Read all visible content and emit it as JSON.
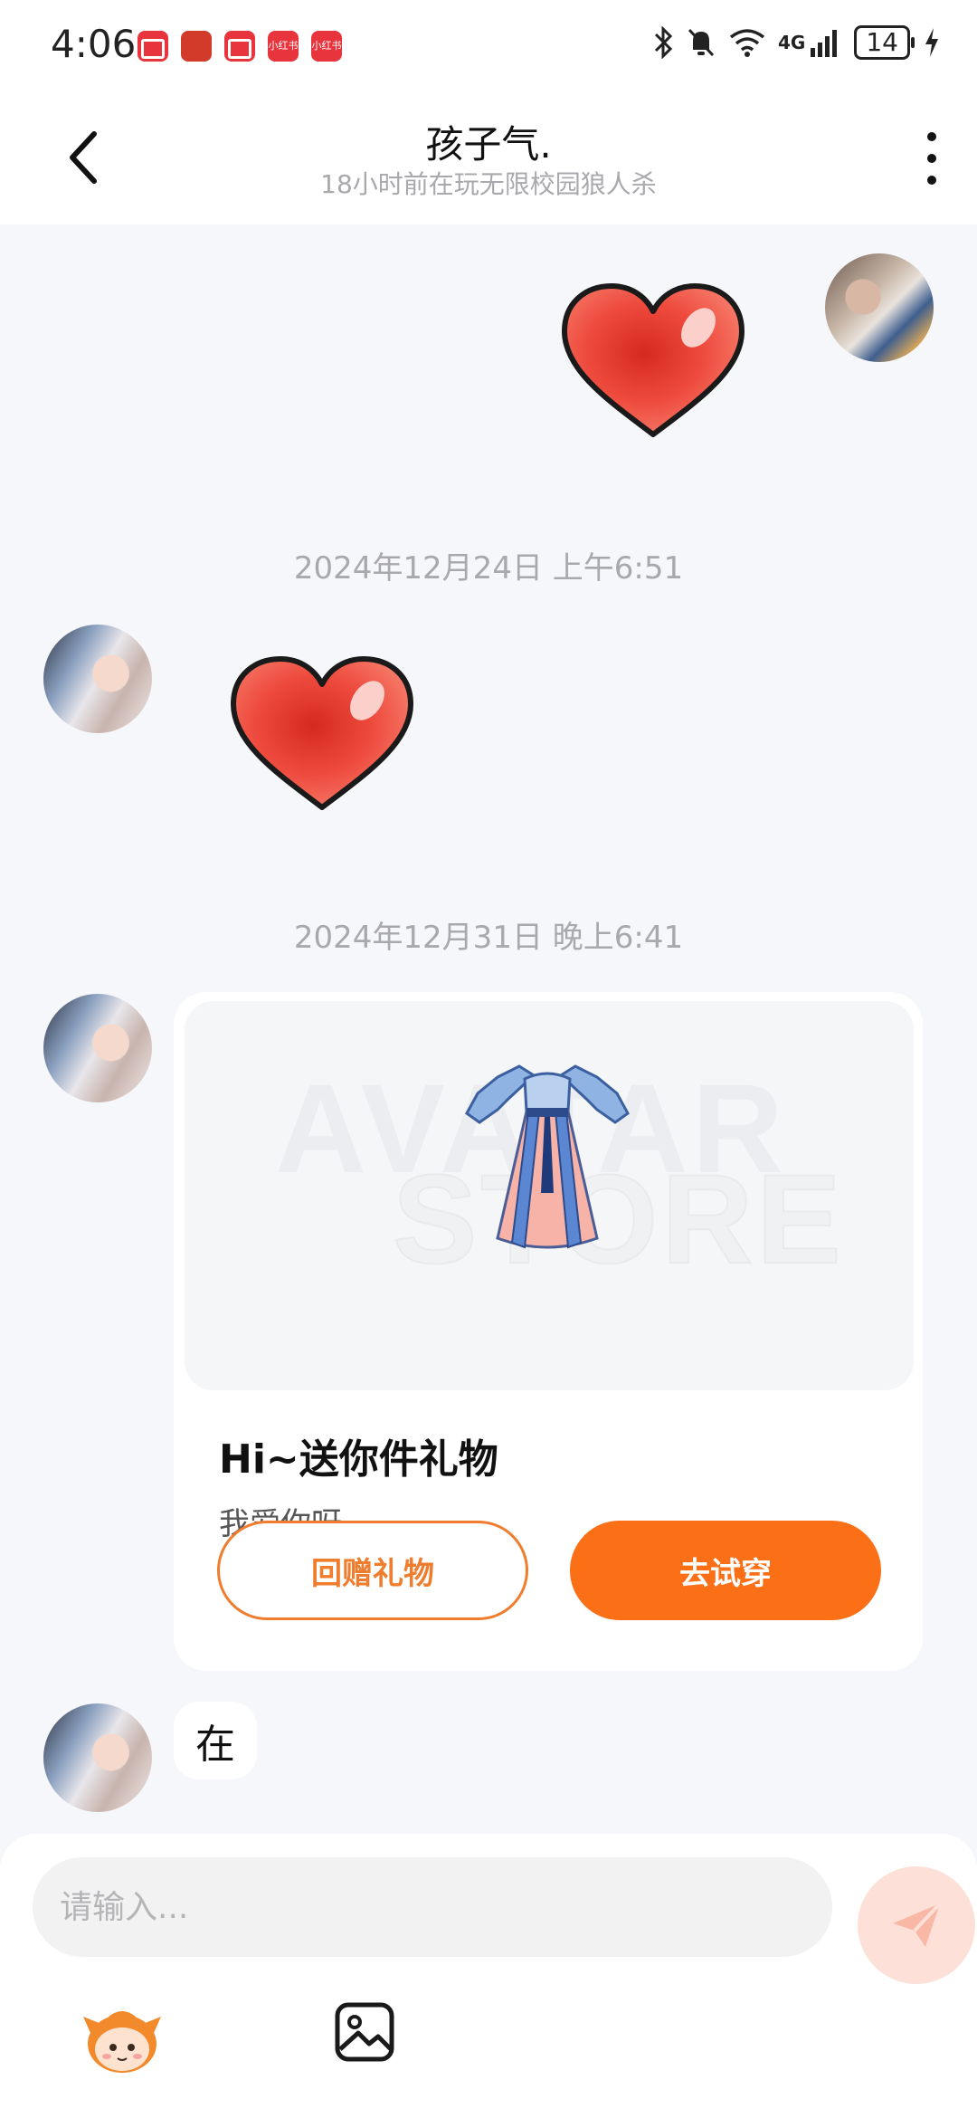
{
  "status_bar": {
    "time": "4:06",
    "battery": "14",
    "notifications": [
      {
        "icon": "rednote-app-icon",
        "label": ""
      },
      {
        "icon": "game-app-icon",
        "label": ""
      },
      {
        "icon": "rednote-app-icon",
        "label": ""
      },
      {
        "icon": "xiaohongshu-app-icon",
        "label": "小红书"
      },
      {
        "icon": "xiaohongshu-app-icon",
        "label": "小红书"
      }
    ],
    "right_icons": [
      "bluetooth-icon",
      "mute-icon",
      "wifi-icon",
      "signal-icon",
      "battery-icon",
      "charging-icon"
    ],
    "network_label": "4G"
  },
  "header": {
    "title": "孩子气.",
    "subtitle": "18小时前在玩无限校园狼人杀"
  },
  "messages": {
    "timestamp_1": "2024年12月24日 上午6:51",
    "timestamp_2": "2024年12月31日 晚上6:41",
    "gift": {
      "title": "Hi~送你件礼物",
      "message": "我爱你呀",
      "return_label": "回赠礼物",
      "try_label": "去试穿",
      "watermark_1": "AVATAR",
      "watermark_2": "STORE"
    },
    "text_message": "在"
  },
  "input": {
    "placeholder": "请输入..."
  },
  "colors": {
    "accent": "#fb7016",
    "heart": "#e8413b",
    "background": "#f6f7fa"
  }
}
